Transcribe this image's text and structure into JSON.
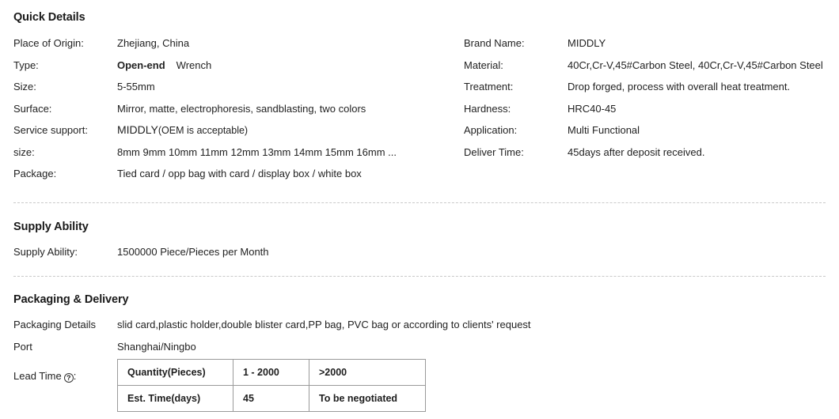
{
  "quick_details": {
    "title": "Quick Details",
    "left_rows": [
      {
        "label": "Place of Origin:",
        "value": "Zhejiang, China"
      },
      {
        "label": "Type:",
        "value_bold": "Open-end",
        "value_rest": "Wrench"
      },
      {
        "label": "Size:",
        "value": "5-55mm"
      },
      {
        "label": "Surface:",
        "value": "Mirror, matte, electrophoresis, sandblasting, two colors"
      },
      {
        "label": "Service support:",
        "value_big": "MIDDLY",
        "value_small": "(OEM is acceptable)"
      },
      {
        "label": "size:",
        "value": "8mm 9mm 10mm 11mm 12mm 13mm 14mm 15mm 16mm ..."
      },
      {
        "label": "Package:",
        "value": "Tied card / opp bag with card / display box / white box"
      }
    ],
    "right_rows": [
      {
        "label": "Brand Name:",
        "value": "MIDDLY"
      },
      {
        "label": "Material:",
        "value": "40Cr,Cr-V,45#Carbon Steel, 40Cr,Cr-V,45#Carbon Steel"
      },
      {
        "label": "Treatment:",
        "value": "Drop forged, process with overall heat treatment."
      },
      {
        "label": "Hardness:",
        "value": "HRC40-45"
      },
      {
        "label": "Application:",
        "value": "Multi Functional"
      },
      {
        "label": "Deliver Time:",
        "value": "45days after deposit received."
      }
    ]
  },
  "supply_ability": {
    "title": "Supply Ability",
    "row": {
      "label": "Supply Ability:",
      "value": "1500000 Piece/Pieces per Month"
    }
  },
  "packaging_delivery": {
    "title": "Packaging & Delivery",
    "rows": [
      {
        "label": "Packaging Details",
        "value": "slid card,plastic holder,double blister card,PP bag, PVC bag or according to clients' request"
      },
      {
        "label": "Port",
        "value": "Shanghai/Ningbo"
      }
    ],
    "lead_time": {
      "label": "Lead Time",
      "help_icon": "question-mark-icon",
      "help_glyph": "?",
      "colon": ":",
      "table": {
        "row_quantity": {
          "header": "Quantity(Pieces)",
          "tier_1": "1 - 2000",
          "tier_2": ">2000"
        },
        "row_est_time": {
          "header": "Est. Time(days)",
          "tier_1": "45",
          "tier_2": "To be negotiated"
        }
      }
    }
  },
  "colors": {
    "text": "#222222",
    "heading": "#1a1a1a",
    "divider": "#c9c9c9",
    "table_border": "#9a9a9a",
    "background": "#ffffff"
  }
}
